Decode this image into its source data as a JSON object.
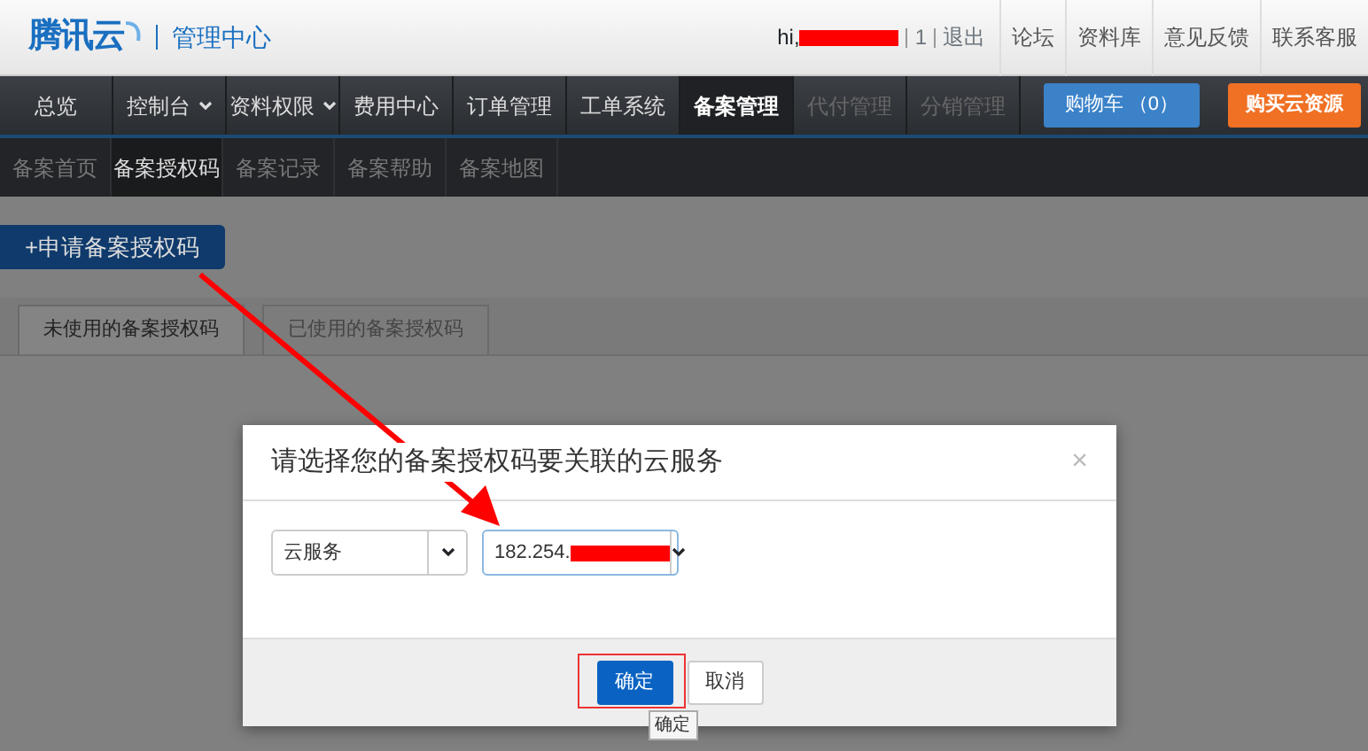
{
  "header": {
    "logo": "腾讯云",
    "title": "管理中心",
    "user": {
      "greeting": "hi,",
      "account_count": "1",
      "logout": "退出"
    },
    "links": [
      "论坛",
      "资料库",
      "意见反馈",
      "联系客服"
    ]
  },
  "main_nav": [
    {
      "label": "总览",
      "selected": false,
      "disabled": false,
      "dropdown": false
    },
    {
      "label": "控制台",
      "selected": false,
      "disabled": false,
      "dropdown": true
    },
    {
      "label": "资料权限",
      "selected": false,
      "disabled": false,
      "dropdown": true
    },
    {
      "label": "费用中心",
      "selected": false,
      "disabled": false,
      "dropdown": false
    },
    {
      "label": "订单管理",
      "selected": false,
      "disabled": false,
      "dropdown": false
    },
    {
      "label": "工单系统",
      "selected": false,
      "disabled": false,
      "dropdown": false
    },
    {
      "label": "备案管理",
      "selected": true,
      "disabled": false,
      "dropdown": false
    },
    {
      "label": "代付管理",
      "selected": false,
      "disabled": true,
      "dropdown": false
    },
    {
      "label": "分销管理",
      "selected": false,
      "disabled": true,
      "dropdown": false
    }
  ],
  "cart_button": "购物车 （0）",
  "buy_button": "购买云资源",
  "sub_nav": [
    {
      "label": "备案首页",
      "selected": false
    },
    {
      "label": "备案授权码",
      "selected": true
    },
    {
      "label": "备案记录",
      "selected": false
    },
    {
      "label": "备案帮助",
      "selected": false
    },
    {
      "label": "备案地图",
      "selected": false
    }
  ],
  "apply_button": "+申请备案授权码",
  "tabs": [
    {
      "label": "未使用的备案授权码",
      "selected": true
    },
    {
      "label": "已使用的备案授权码",
      "selected": false
    }
  ],
  "dialog": {
    "title": "请选择您的备案授权码要关联的云服务",
    "close": "×",
    "selects": [
      {
        "value": "云服务",
        "focused": false
      },
      {
        "value": "182.254.",
        "focused": true
      }
    ],
    "buttons": [
      {
        "label": "确定",
        "kind": "primary"
      },
      {
        "label": "取消",
        "kind": "default"
      }
    ],
    "tooltip": "确定"
  }
}
